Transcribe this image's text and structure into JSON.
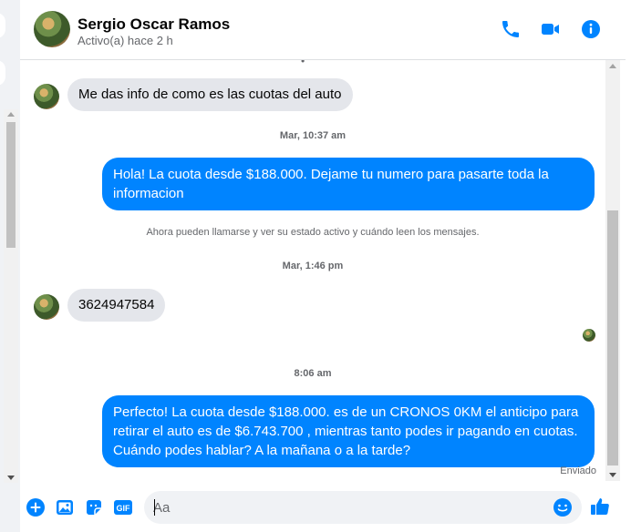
{
  "header": {
    "name": "Sergio Oscar Ramos",
    "status": "Activo(a) hace 2 h"
  },
  "icons": {
    "phone": "phone-icon",
    "video": "video-icon",
    "info": "info-icon"
  },
  "colors": {
    "accent": "#0084ff",
    "incoming_bubble": "#e4e6eb",
    "secondary_text": "#65676b"
  },
  "messages": [
    {
      "type": "incoming",
      "text": "Me das info de como es las cuotas del auto"
    },
    {
      "type": "timestamp",
      "text": "Mar, 10:37 am"
    },
    {
      "type": "outgoing",
      "text": "Hola! La cuota desde $188.000. Dejame tu numero para pasarte toda la informacion"
    },
    {
      "type": "system",
      "text": "Ahora pueden llamarse y ver su estado activo y cuándo leen los mensajes."
    },
    {
      "type": "timestamp",
      "text": "Mar, 1:46 pm"
    },
    {
      "type": "incoming",
      "text": "3624947584"
    },
    {
      "type": "timestamp",
      "text": "8:06 am"
    },
    {
      "type": "outgoing",
      "text": "Perfecto! La cuota desde $188.000. es de un CRONOS 0KM el anticipo para retirar el auto es de $6.743.700 , mientras tanto podes ir pagando en cuotas. Cuándo podes hablar? A la mañana o a la tarde?"
    }
  ],
  "delivery_status": "Enviado",
  "composer": {
    "placeholder": "Aa",
    "gif_label": "GIF"
  }
}
